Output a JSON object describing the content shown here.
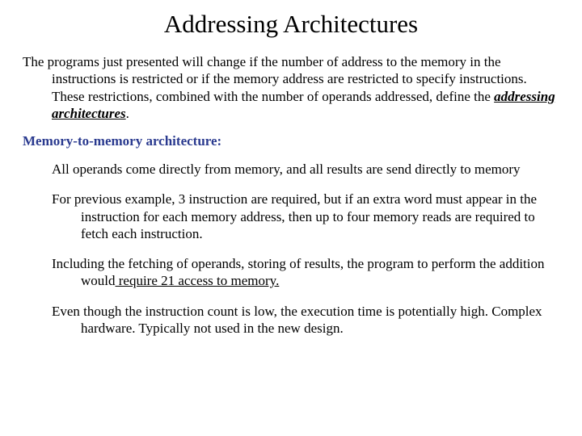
{
  "title": "Addressing Architectures",
  "intro_a": "The programs just presented will change if the number of address to the memory in the instructions is restricted or if the memory address are restricted to specify instructions. These restrictions, combined with the number of operands addressed, define the ",
  "intro_emph": "addressing architectures",
  "intro_b": ".",
  "section_heading": "Memory-to-memory architecture:",
  "p1": "All operands come directly from memory, and all results are send directly to memory",
  "p2": "For previous example, 3 instruction are required, but if an extra word must appear in the instruction for each memory address, then up to four memory reads are required to fetch each instruction.",
  "p3_a": "Including the fetching of operands, storing of results, the program to perform the addition would",
  "p3_u": " require 21 access to memory.",
  "p4": "Even though the instruction count is low, the execution time is potentially high. Complex hardware. Typically not used in the new design."
}
